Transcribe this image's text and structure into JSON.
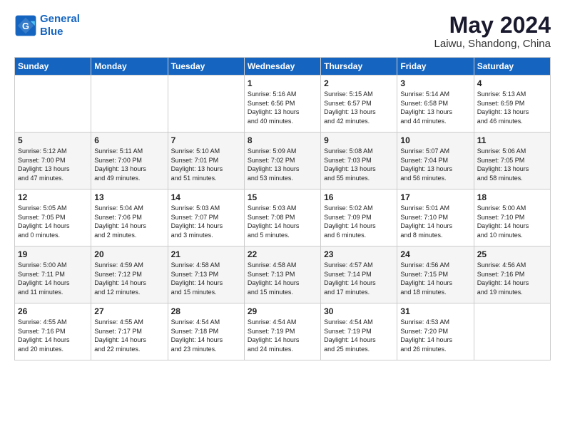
{
  "logo": {
    "line1": "General",
    "line2": "Blue"
  },
  "title": "May 2024",
  "subtitle": "Laiwu, Shandong, China",
  "days_of_week": [
    "Sunday",
    "Monday",
    "Tuesday",
    "Wednesday",
    "Thursday",
    "Friday",
    "Saturday"
  ],
  "weeks": [
    [
      {
        "day": "",
        "info": ""
      },
      {
        "day": "",
        "info": ""
      },
      {
        "day": "",
        "info": ""
      },
      {
        "day": "1",
        "info": "Sunrise: 5:16 AM\nSunset: 6:56 PM\nDaylight: 13 hours\nand 40 minutes."
      },
      {
        "day": "2",
        "info": "Sunrise: 5:15 AM\nSunset: 6:57 PM\nDaylight: 13 hours\nand 42 minutes."
      },
      {
        "day": "3",
        "info": "Sunrise: 5:14 AM\nSunset: 6:58 PM\nDaylight: 13 hours\nand 44 minutes."
      },
      {
        "day": "4",
        "info": "Sunrise: 5:13 AM\nSunset: 6:59 PM\nDaylight: 13 hours\nand 46 minutes."
      }
    ],
    [
      {
        "day": "5",
        "info": "Sunrise: 5:12 AM\nSunset: 7:00 PM\nDaylight: 13 hours\nand 47 minutes."
      },
      {
        "day": "6",
        "info": "Sunrise: 5:11 AM\nSunset: 7:00 PM\nDaylight: 13 hours\nand 49 minutes."
      },
      {
        "day": "7",
        "info": "Sunrise: 5:10 AM\nSunset: 7:01 PM\nDaylight: 13 hours\nand 51 minutes."
      },
      {
        "day": "8",
        "info": "Sunrise: 5:09 AM\nSunset: 7:02 PM\nDaylight: 13 hours\nand 53 minutes."
      },
      {
        "day": "9",
        "info": "Sunrise: 5:08 AM\nSunset: 7:03 PM\nDaylight: 13 hours\nand 55 minutes."
      },
      {
        "day": "10",
        "info": "Sunrise: 5:07 AM\nSunset: 7:04 PM\nDaylight: 13 hours\nand 56 minutes."
      },
      {
        "day": "11",
        "info": "Sunrise: 5:06 AM\nSunset: 7:05 PM\nDaylight: 13 hours\nand 58 minutes."
      }
    ],
    [
      {
        "day": "12",
        "info": "Sunrise: 5:05 AM\nSunset: 7:05 PM\nDaylight: 14 hours\nand 0 minutes."
      },
      {
        "day": "13",
        "info": "Sunrise: 5:04 AM\nSunset: 7:06 PM\nDaylight: 14 hours\nand 2 minutes."
      },
      {
        "day": "14",
        "info": "Sunrise: 5:03 AM\nSunset: 7:07 PM\nDaylight: 14 hours\nand 3 minutes."
      },
      {
        "day": "15",
        "info": "Sunrise: 5:03 AM\nSunset: 7:08 PM\nDaylight: 14 hours\nand 5 minutes."
      },
      {
        "day": "16",
        "info": "Sunrise: 5:02 AM\nSunset: 7:09 PM\nDaylight: 14 hours\nand 6 minutes."
      },
      {
        "day": "17",
        "info": "Sunrise: 5:01 AM\nSunset: 7:10 PM\nDaylight: 14 hours\nand 8 minutes."
      },
      {
        "day": "18",
        "info": "Sunrise: 5:00 AM\nSunset: 7:10 PM\nDaylight: 14 hours\nand 10 minutes."
      }
    ],
    [
      {
        "day": "19",
        "info": "Sunrise: 5:00 AM\nSunset: 7:11 PM\nDaylight: 14 hours\nand 11 minutes."
      },
      {
        "day": "20",
        "info": "Sunrise: 4:59 AM\nSunset: 7:12 PM\nDaylight: 14 hours\nand 12 minutes."
      },
      {
        "day": "21",
        "info": "Sunrise: 4:58 AM\nSunset: 7:13 PM\nDaylight: 14 hours\nand 15 minutes."
      },
      {
        "day": "22",
        "info": "Sunrise: 4:58 AM\nSunset: 7:13 PM\nDaylight: 14 hours\nand 15 minutes."
      },
      {
        "day": "23",
        "info": "Sunrise: 4:57 AM\nSunset: 7:14 PM\nDaylight: 14 hours\nand 17 minutes."
      },
      {
        "day": "24",
        "info": "Sunrise: 4:56 AM\nSunset: 7:15 PM\nDaylight: 14 hours\nand 18 minutes."
      },
      {
        "day": "25",
        "info": "Sunrise: 4:56 AM\nSunset: 7:16 PM\nDaylight: 14 hours\nand 19 minutes."
      }
    ],
    [
      {
        "day": "26",
        "info": "Sunrise: 4:55 AM\nSunset: 7:16 PM\nDaylight: 14 hours\nand 20 minutes."
      },
      {
        "day": "27",
        "info": "Sunrise: 4:55 AM\nSunset: 7:17 PM\nDaylight: 14 hours\nand 22 minutes."
      },
      {
        "day": "28",
        "info": "Sunrise: 4:54 AM\nSunset: 7:18 PM\nDaylight: 14 hours\nand 23 minutes."
      },
      {
        "day": "29",
        "info": "Sunrise: 4:54 AM\nSunset: 7:19 PM\nDaylight: 14 hours\nand 24 minutes."
      },
      {
        "day": "30",
        "info": "Sunrise: 4:54 AM\nSunset: 7:19 PM\nDaylight: 14 hours\nand 25 minutes."
      },
      {
        "day": "31",
        "info": "Sunrise: 4:53 AM\nSunset: 7:20 PM\nDaylight: 14 hours\nand 26 minutes."
      },
      {
        "day": "",
        "info": ""
      }
    ]
  ]
}
